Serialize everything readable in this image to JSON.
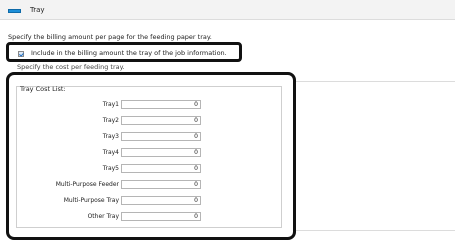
{
  "header": {
    "title": "Tray",
    "icon": "tray-icon"
  },
  "description": "Specify the billing amount per page for the feeding paper tray.",
  "include_option": {
    "label": "Include in the billing amount the tray of the job information.",
    "checked": true
  },
  "cost_hint": "Specify the cost per feeding tray.",
  "cost_list": {
    "title": "Tray Cost List:",
    "rows": [
      {
        "label": "Tray1",
        "value": "0"
      },
      {
        "label": "Tray2",
        "value": "0"
      },
      {
        "label": "Tray3",
        "value": "0"
      },
      {
        "label": "Tray4",
        "value": "0"
      },
      {
        "label": "Tray5",
        "value": "0"
      },
      {
        "label": "Multi-Purpose Feeder",
        "value": "0"
      },
      {
        "label": "Multi-Purpose Tray",
        "value": "0"
      },
      {
        "label": "Other Tray",
        "value": "0"
      }
    ]
  }
}
